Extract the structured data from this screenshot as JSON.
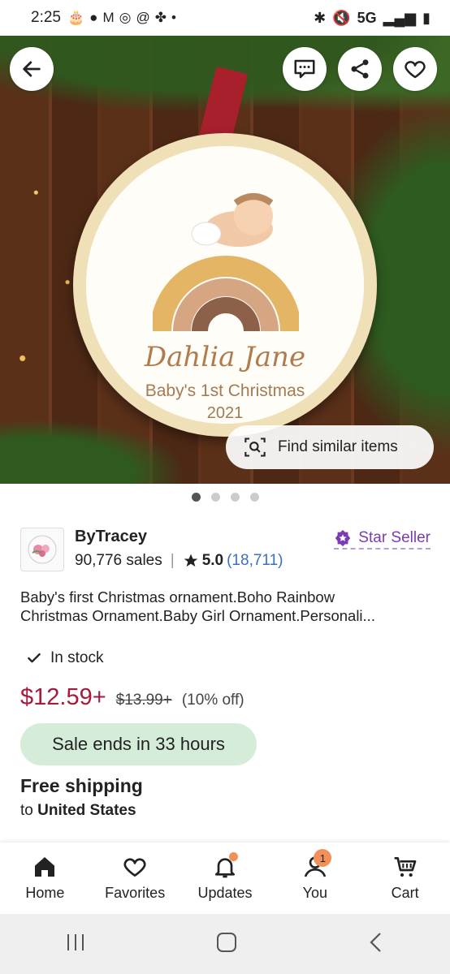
{
  "status_bar": {
    "time": "2:25",
    "network": "5G"
  },
  "listing": {
    "ornament": {
      "name": "Dahlia Jane",
      "line1": "Baby's 1st Christmas",
      "line2": "2021"
    },
    "find_similar_label": "Find similar items",
    "image_count": 4,
    "active_image_index": 0,
    "shop": {
      "name": "ByTracey",
      "sales": "90,776 sales",
      "rating": "5.0",
      "reviews": "(18,711)",
      "badge": "Star Seller"
    },
    "title_line1": "Baby's first Christmas ornament.Boho Rainbow",
    "title_line2": "Christmas Ornament.Baby Girl Ornament.Personali...",
    "stock": "In stock",
    "price": "$12.59+",
    "original_price": "$13.99+",
    "discount": "(10% off)",
    "sale_banner": "Sale ends in 33 hours",
    "shipping_title": "Free shipping",
    "shipping_to_prefix": "to",
    "shipping_country": "United States"
  },
  "tabs": [
    {
      "label": "Home",
      "icon": "home-icon"
    },
    {
      "label": "Favorites",
      "icon": "heart-icon"
    },
    {
      "label": "Updates",
      "icon": "bell-icon"
    },
    {
      "label": "You",
      "icon": "person-icon",
      "badge": "1"
    },
    {
      "label": "Cart",
      "icon": "cart-icon"
    }
  ],
  "colors": {
    "price": "#a61a3c",
    "sale_bg": "#d5ecd9",
    "star_seller": "#7a3cb3",
    "badge": "#f19159"
  }
}
